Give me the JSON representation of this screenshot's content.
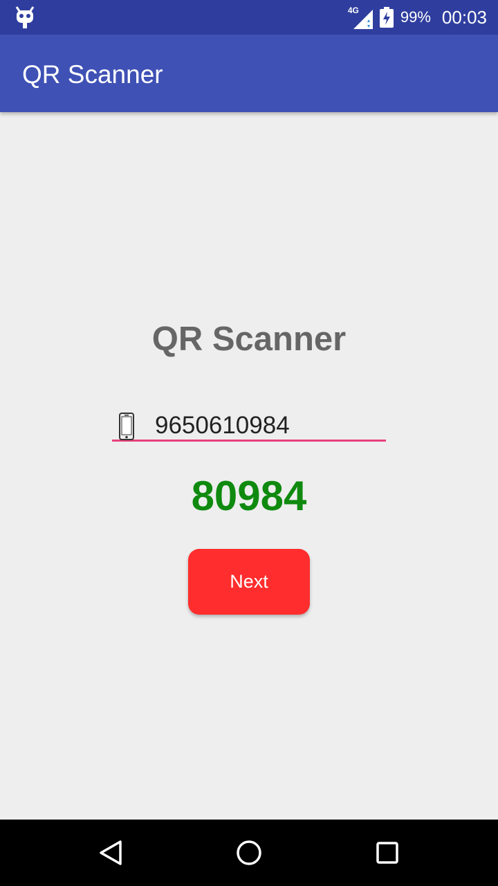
{
  "status_bar": {
    "notification_icon": "cyanogen-bug-icon",
    "network_label": "4G",
    "signal_icon": "signal-icon",
    "battery_icon": "battery-charging-icon",
    "battery_percent": "99%",
    "time": "00:03"
  },
  "app_bar": {
    "title": "QR Scanner"
  },
  "main": {
    "heading": "QR Scanner",
    "phone_field": {
      "icon": "smartphone-icon",
      "value": "9650610984",
      "accent_color": "#e8417c"
    },
    "code": "80984",
    "code_color": "#0f8a0f",
    "next_button": {
      "label": "Next",
      "color": "#ff2d2d"
    }
  },
  "nav_bar": {
    "back_icon": "back-triangle-icon",
    "home_icon": "home-circle-icon",
    "recents_icon": "recents-square-icon"
  },
  "colors": {
    "primary": "#3f51b5",
    "primary_dark": "#2f3e9e",
    "background": "#eeeeee"
  }
}
